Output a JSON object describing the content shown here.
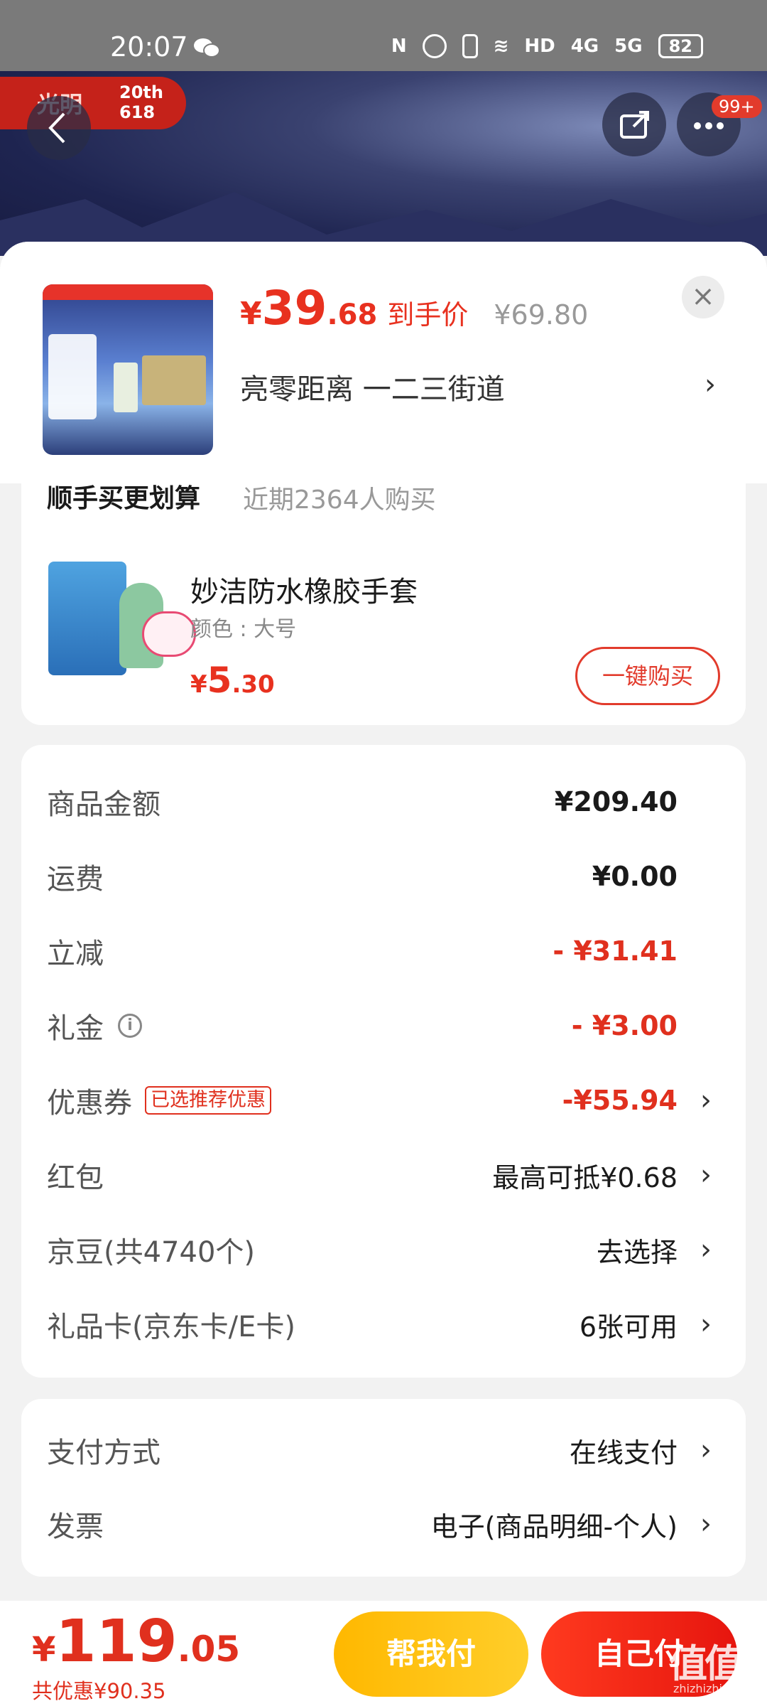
{
  "status_bar": {
    "time": "20:07",
    "network": "4G",
    "network2": "5G",
    "hd": "HD",
    "battery": "82"
  },
  "hero": {
    "brand_name": "光明",
    "brand_event": "20th 618",
    "notification_count": "99+"
  },
  "product": {
    "price_symbol": "¥",
    "price_int": "39",
    "price_dec": ".68",
    "price_label": "到手价",
    "original_price": "¥69.80",
    "address": "亮零距离  一二三街道",
    "close": "×"
  },
  "upsell": {
    "title": "顺手买更划算",
    "subtitle": "近期2364人购买",
    "item_name": "妙洁防水橡胶手套",
    "item_spec": "颜色 : 大号",
    "item_price_symbol": "¥",
    "item_price_int": "5",
    "item_price_dec": ".30",
    "buy_label": "一键购买"
  },
  "fees": [
    {
      "label": "商品金额",
      "value": "¥209.40"
    },
    {
      "label": "运费",
      "value": "¥0.00"
    },
    {
      "label": "立减",
      "value": "- ¥31.41"
    },
    {
      "label": "礼金",
      "value": "- ¥3.00"
    },
    {
      "label": "优惠券",
      "tag": "已选推荐优惠",
      "value": "-¥55.94"
    },
    {
      "label": "红包",
      "value": "最高可抵¥0.68"
    },
    {
      "label": "京豆(共4740个)",
      "value": "去选择"
    },
    {
      "label": "礼品卡(京东卡/E卡)",
      "value": "6张可用"
    }
  ],
  "payment": [
    {
      "label": "支付方式",
      "value": "在线支付"
    },
    {
      "label": "发票",
      "value": "电子(商品明细-个人)"
    }
  ],
  "bottom": {
    "total_symbol": "¥",
    "total_int": "119",
    "total_dec": ".05",
    "saving": "共优惠¥90.35",
    "help_pay": "帮我付",
    "self_pay": "自己付"
  },
  "watermark": {
    "logo": "值值值",
    "site": "zhizhizhi.com"
  },
  "colors": {
    "accent_red": "#e8311f",
    "help_button": "#ffb800"
  }
}
